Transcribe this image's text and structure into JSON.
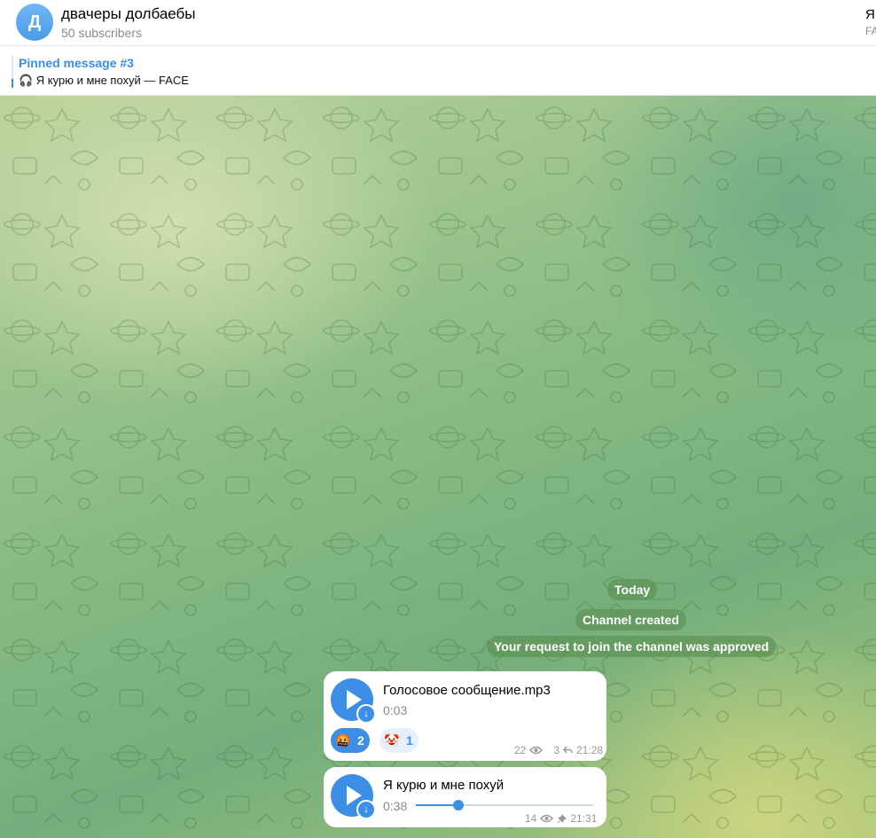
{
  "channel": {
    "avatar_letter": "Д",
    "name": "двачеры долбаебы",
    "subscribers": "50 subscribers"
  },
  "side_panel": {
    "title": "Я",
    "subtitle": "FA"
  },
  "pinned": {
    "title": "Pinned message #3",
    "icon": "headphones-icon",
    "text": "🎧 Я курю и мне похуй — FACE"
  },
  "service_messages": {
    "date": "Today",
    "created": "Channel created",
    "approved": "Your request to join the channel was approved"
  },
  "messages": [
    {
      "title": "Голосовое сообщение.mp3",
      "duration": "0:03",
      "reactions": [
        {
          "emoji": "🤬",
          "count": "2",
          "active": true
        },
        {
          "emoji": "🤡",
          "count": "1",
          "active": false
        }
      ],
      "views": "22",
      "replies": "3",
      "time": "21:28"
    },
    {
      "title": "Я курю и мне похуй",
      "duration": "0:38",
      "progress": 0.24,
      "views": "14",
      "time": "21:31"
    }
  ],
  "colors": {
    "accent": "#3d8fe6",
    "service_bg": "#6a9a5e"
  }
}
